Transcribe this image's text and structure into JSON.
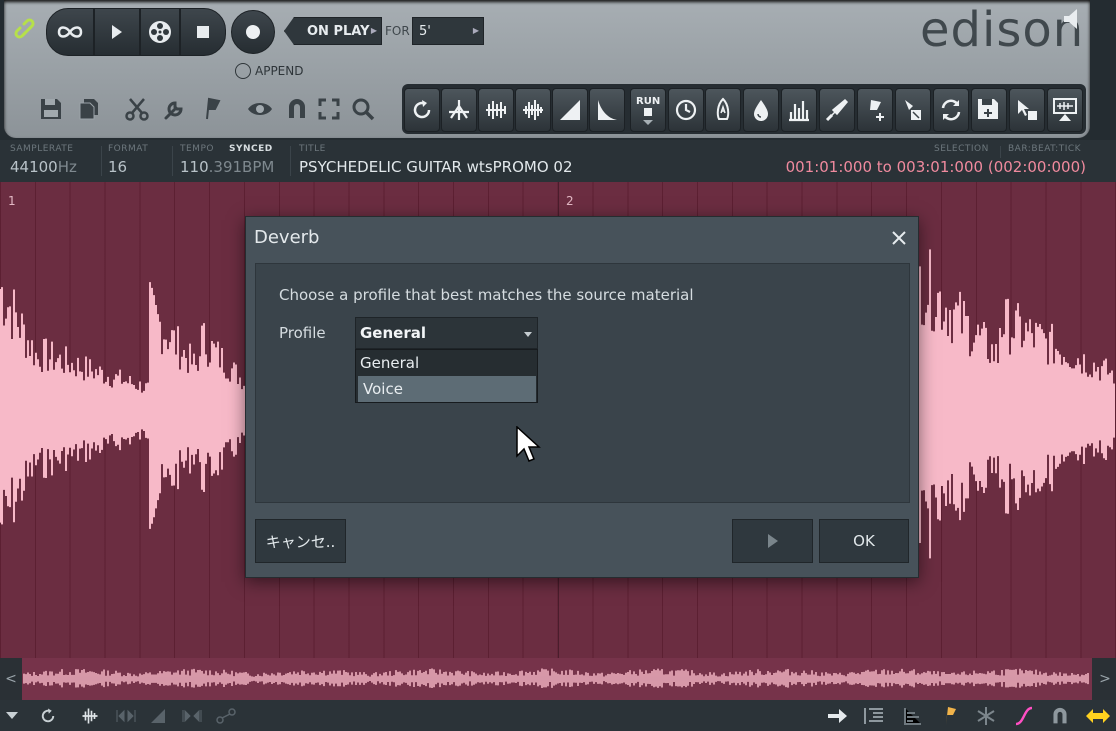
{
  "toolbar": {
    "onplay_label": "ON PLAY",
    "for_label": "FOR",
    "for_value": "5'",
    "append_label": "APPEND",
    "logo": "edison"
  },
  "info": {
    "samplerate_label": "SAMPLERATE",
    "samplerate_value": "44100",
    "samplerate_unit": "Hz",
    "format_label": "FORMAT",
    "format_value": "16",
    "tempo_label": "TEMPO",
    "tempo_synced": "SYNCED",
    "tempo_int": "110",
    "tempo_frac": ".391BPM",
    "title_label": "TITLE",
    "title_value": "PSYCHEDELIC GUITAR wtsPROMO 02",
    "selection_label": "SELECTION",
    "barbeattick_label": "BAR:BEAT:TICK",
    "selection_value": "001:01:000 to 003:01:000 (002:00:000)"
  },
  "waveform": {
    "bar_numbers": [
      "1",
      "2"
    ]
  },
  "dialog": {
    "title": "Deverb",
    "prompt": "Choose a profile that best matches the source material",
    "profile_label": "Profile",
    "profile_selected": "General",
    "options": [
      "General",
      "Voice"
    ],
    "highlighted_option": "Voice",
    "cancel_label": "キャンセ..",
    "ok_label": "OK"
  },
  "colors": {
    "waveform_bg": "#6b2d41",
    "waveform_fill": "#f7b9c8",
    "selection_text": "#f08a9e",
    "dialog_bg": "#47525a"
  }
}
